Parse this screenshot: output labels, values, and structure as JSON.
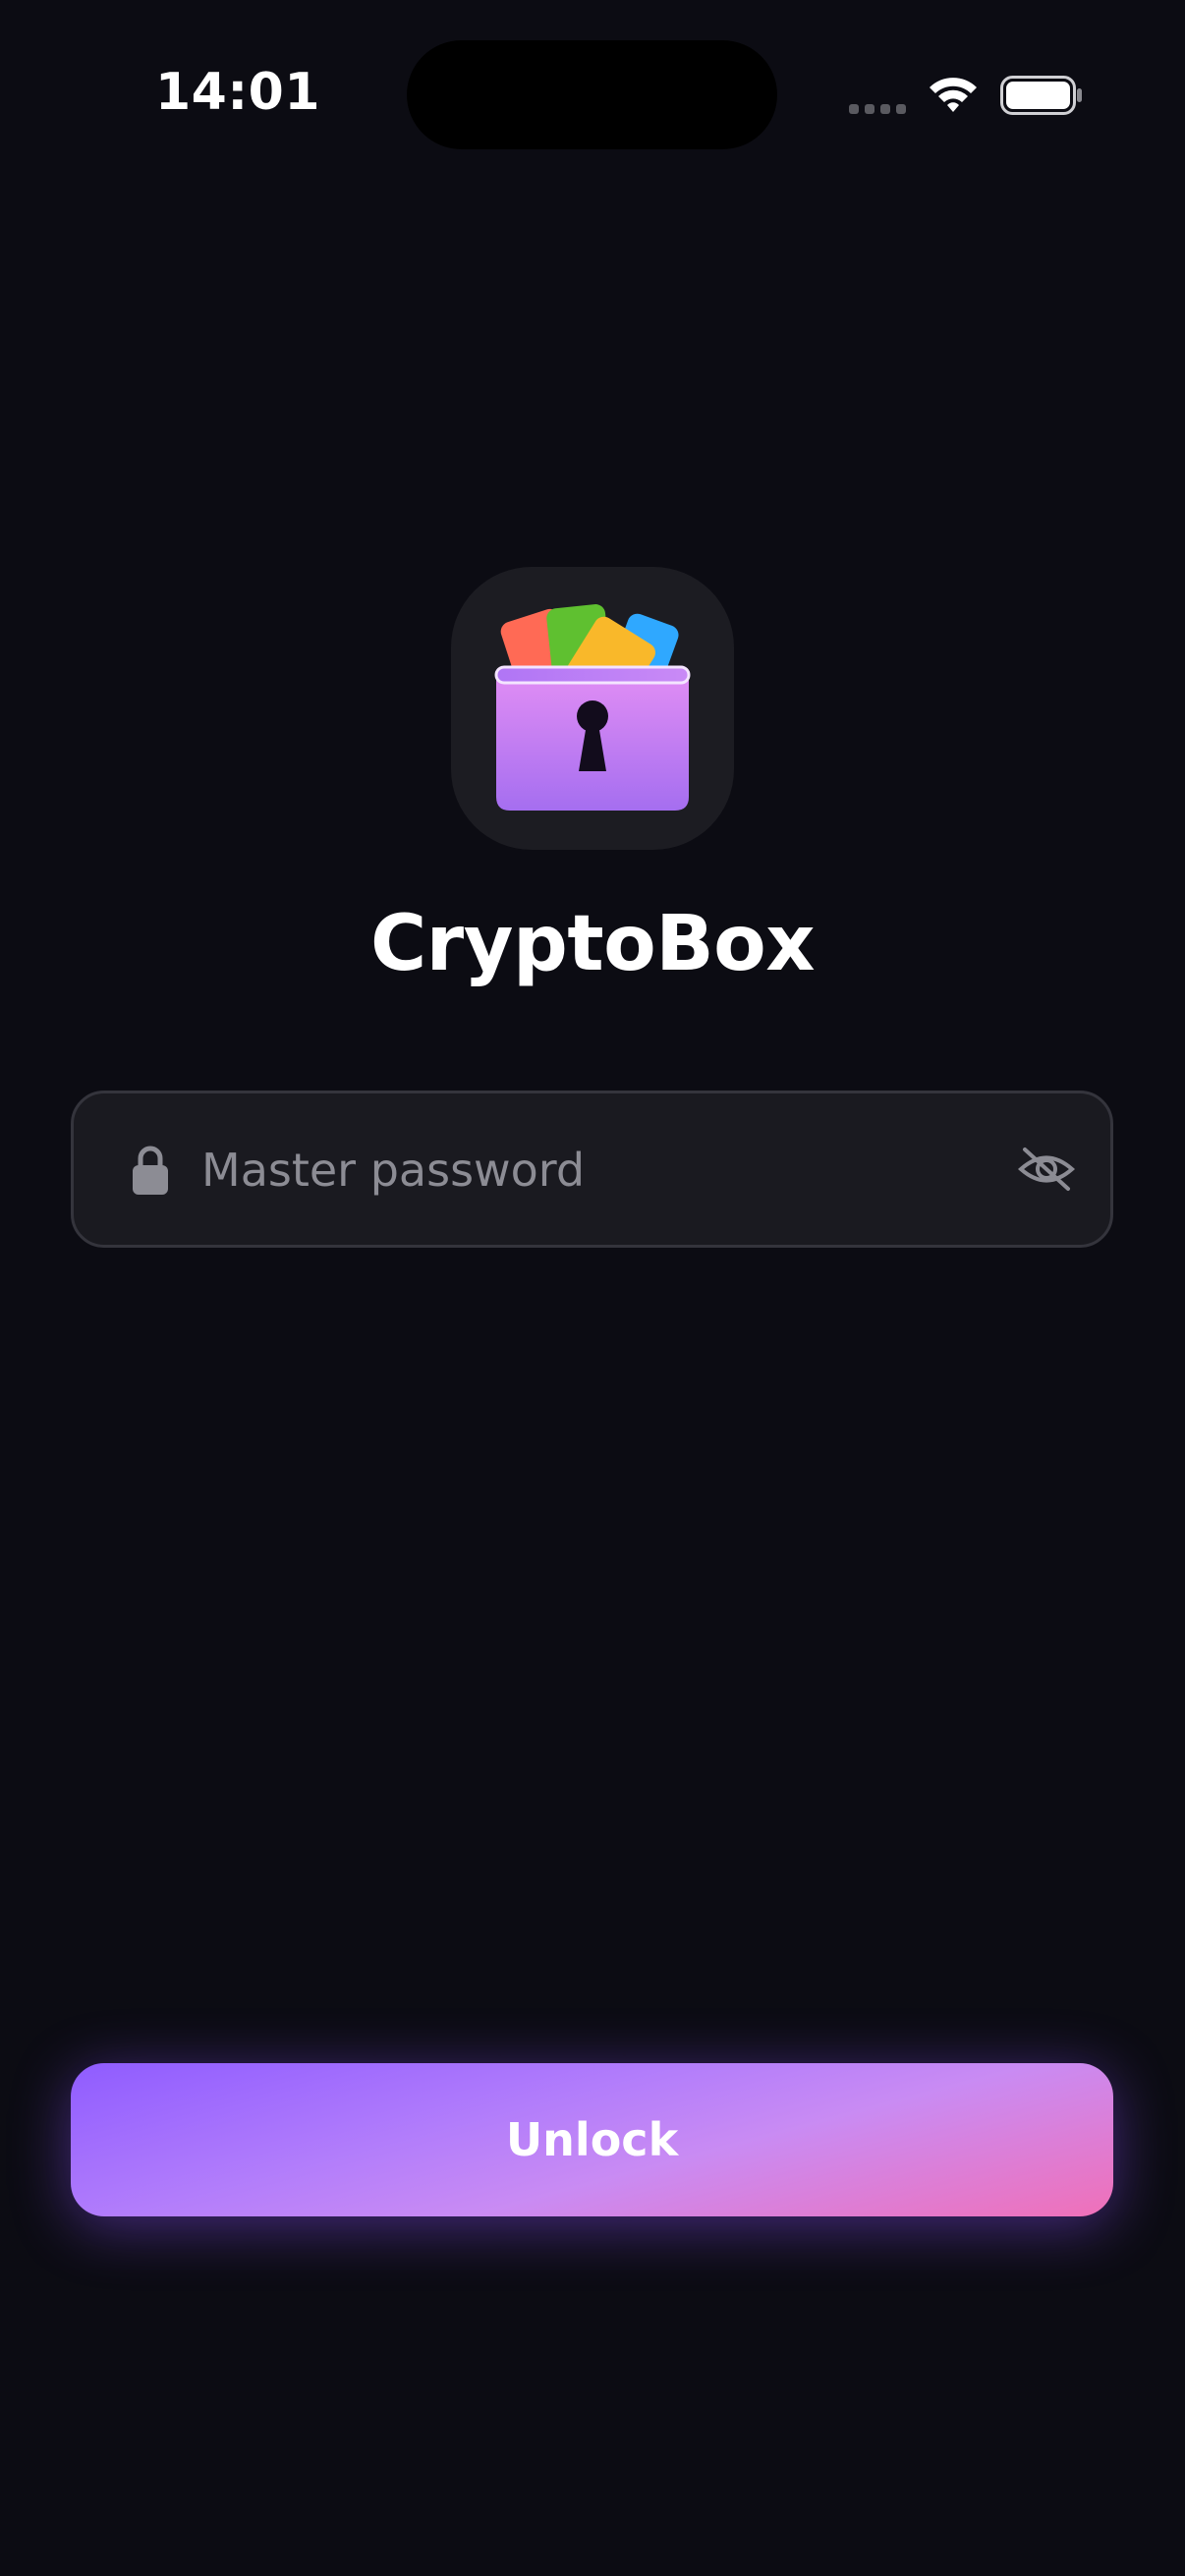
{
  "status_bar": {
    "time": "14:01"
  },
  "app": {
    "name": "CryptoBox",
    "icon": "cryptobox-app-icon"
  },
  "password_field": {
    "placeholder": "Master password",
    "value": "",
    "leading_icon": "lock-icon",
    "trailing_icon": "eye-off-icon"
  },
  "unlock_button": {
    "label": "Unlock"
  },
  "colors": {
    "background": "#0c0c13",
    "field_background": "#1a1a20",
    "field_border": "#34343c",
    "button_gradient_start": "#8f5cff",
    "button_gradient_end": "#f070b8"
  }
}
